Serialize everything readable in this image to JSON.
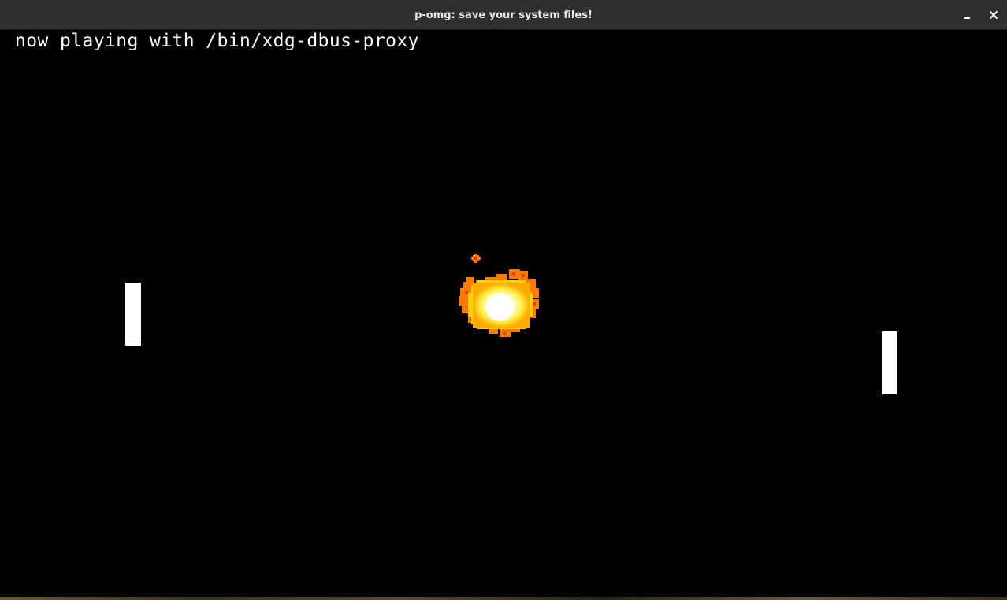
{
  "window": {
    "title": "p-omg: save your system files!",
    "controls": {
      "minimize_icon": "minimize-icon",
      "close_icon": "close-icon"
    }
  },
  "game": {
    "status_text": "now playing with /bin/xdg-dbus-proxy",
    "background_color": "#000000",
    "paddle_color": "#ffffff",
    "explosion_colors": [
      "#ffffff",
      "#ffff66",
      "#ffcc00",
      "#ff8800",
      "#ff4400"
    ]
  }
}
